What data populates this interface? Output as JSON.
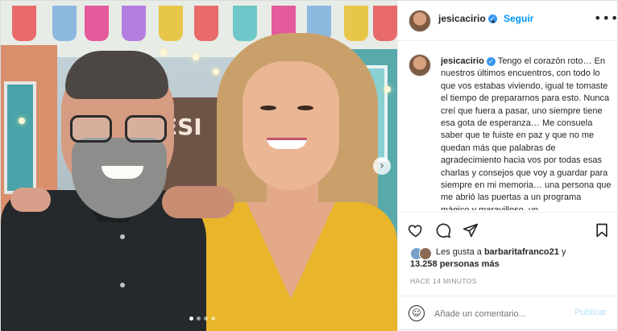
{
  "colors": {
    "accent": "#0095f6",
    "verified": "#3897f0",
    "text": "#262626",
    "muted": "#8e8e8e",
    "publish_disabled": "#b2dffc"
  },
  "photo": {
    "sign_text": "ESI",
    "next_icon": "chevron-right-icon",
    "carousel_total": 4,
    "carousel_active": 0
  },
  "header": {
    "username": "jesicacirio",
    "verified_icon": "verified-badge-icon",
    "separator": "•",
    "follow_label": "Seguir",
    "more_icon": "ellipsis-icon",
    "more_label": "•••"
  },
  "caption": {
    "username": "jesicacirio",
    "text": "Tengo el corazón roto… En nuestros últimos encuentros, con todo lo que vos estabas viviendo, igual te tomaste el tiempo de prepararnos para esto. Nunca creí que fuera a pasar, uno siempre tiene esa gota de esperanza… Me consuela saber que te fuiste en paz y que no me quedan más que palabras de agradecimiento hacia vos por todas esas charlas y consejos que voy a guardar para siempre en mi memoria… una persona que me abrió las puertas a un programa mágico y maravilloso, un"
  },
  "actions": {
    "like_icon": "heart-icon",
    "comment_icon": "comment-icon",
    "share_icon": "paper-plane-icon",
    "save_icon": "bookmark-icon"
  },
  "likes": {
    "prefix": "Les gusta a",
    "user": "barbaritafranco21",
    "connector": "y",
    "count_text": "13.258 personas más"
  },
  "time_label": "HACE 14 MINUTOS",
  "comment": {
    "placeholder": "Añade un comentario...",
    "publish_label": "Publicar",
    "emoji_icon": "smiley-icon"
  }
}
